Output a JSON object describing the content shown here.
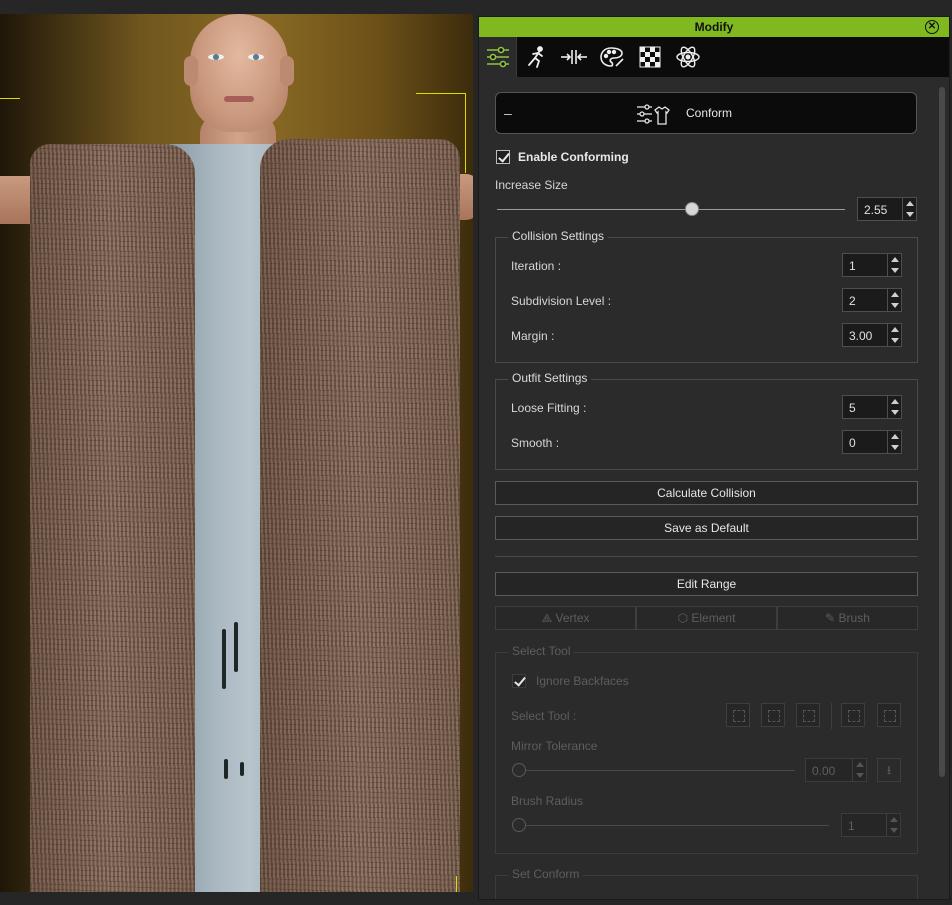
{
  "window": {
    "title": "Modify"
  },
  "tabs": [
    {
      "icon": "sliders-icon"
    },
    {
      "icon": "motion-figure-icon"
    },
    {
      "icon": "conform-arrows-icon"
    },
    {
      "icon": "material-palette-icon"
    },
    {
      "icon": "checker-texture-icon"
    },
    {
      "icon": "atom-physics-icon"
    }
  ],
  "header": {
    "collapse": "–",
    "label": "Conform"
  },
  "enable_conforming": {
    "label": "Enable Conforming",
    "checked": true
  },
  "increase_size": {
    "label": "Increase Size",
    "value": "2.55",
    "fraction": 0.56
  },
  "collision": {
    "title": "Collision Settings",
    "rows": [
      {
        "label": "Iteration :",
        "value": "1"
      },
      {
        "label": "Subdivision Level :",
        "value": "2"
      },
      {
        "label": "Margin :",
        "value": "3.00"
      }
    ]
  },
  "outfit": {
    "title": "Outfit Settings",
    "rows": [
      {
        "label": "Loose Fitting :",
        "value": "5"
      },
      {
        "label": "Smooth :",
        "value": "0"
      }
    ]
  },
  "buttons": {
    "calculate": "Calculate Collision",
    "save_default": "Save as Default",
    "edit_range": "Edit Range"
  },
  "modes": {
    "vertex": "Vertex",
    "element": "Element",
    "brush": "Brush"
  },
  "select_tool_group": {
    "title": "Select Tool",
    "ignore_backfaces": "Ignore Backfaces",
    "select_tool_label": "Select Tool :",
    "mirror_tolerance": "Mirror Tolerance",
    "mirror_value": "0.00",
    "brush_radius": "Brush Radius",
    "brush_value": "1"
  },
  "set_conform": {
    "title": "Set Conform"
  },
  "colors": {
    "accent": "#7fb91f",
    "panel": "#2b2b2b",
    "header_bg": "#0b0b0b"
  }
}
